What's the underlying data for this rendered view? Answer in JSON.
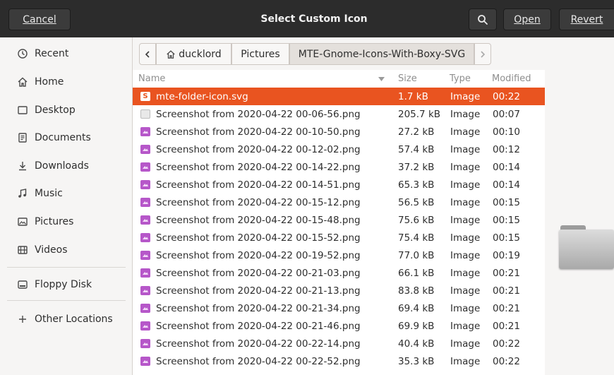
{
  "header": {
    "cancel_label": "Cancel",
    "title": "Select Custom Icon",
    "search_icon": "search-icon",
    "open_label": "Open",
    "revert_label": "Revert"
  },
  "sidebar": {
    "items": [
      {
        "label": "Recent",
        "icon": "clock-icon"
      },
      {
        "label": "Home",
        "icon": "home-icon"
      },
      {
        "label": "Desktop",
        "icon": "desktop-icon"
      },
      {
        "label": "Documents",
        "icon": "document-icon"
      },
      {
        "label": "Downloads",
        "icon": "download-icon"
      },
      {
        "label": "Music",
        "icon": "music-icon"
      },
      {
        "label": "Pictures",
        "icon": "image-icon"
      },
      {
        "label": "Videos",
        "icon": "video-icon"
      },
      {
        "label": "Floppy Disk",
        "icon": "drive-icon"
      },
      {
        "label": "Other Locations",
        "icon": "plus-icon"
      }
    ]
  },
  "pathbar": {
    "segments": [
      "ducklord",
      "Pictures",
      "MTE-Gnome-Icons-With-Boxy-SVG"
    ]
  },
  "list": {
    "columns": {
      "name": "Name",
      "size": "Size",
      "type": "Type",
      "modified": "Modified"
    },
    "rows": [
      {
        "name": "mte-folder-icon.svg",
        "size": "1.7 kB",
        "type": "Image",
        "modified": "00:22",
        "selected": true,
        "icon": "svg-file-icon"
      },
      {
        "name": "Screenshot from 2020-04-22 00-06-56.png",
        "size": "205.7 kB",
        "type": "Image",
        "modified": "00:07",
        "icon": "generic-image-icon"
      },
      {
        "name": "Screenshot from 2020-04-22 00-10-50.png",
        "size": "27.2 kB",
        "type": "Image",
        "modified": "00:10",
        "icon": "png-file-icon"
      },
      {
        "name": "Screenshot from 2020-04-22 00-12-02.png",
        "size": "57.4 kB",
        "type": "Image",
        "modified": "00:12",
        "icon": "png-file-icon"
      },
      {
        "name": "Screenshot from 2020-04-22 00-14-22.png",
        "size": "37.2 kB",
        "type": "Image",
        "modified": "00:14",
        "icon": "png-file-icon"
      },
      {
        "name": "Screenshot from 2020-04-22 00-14-51.png",
        "size": "65.3 kB",
        "type": "Image",
        "modified": "00:14",
        "icon": "png-file-icon"
      },
      {
        "name": "Screenshot from 2020-04-22 00-15-12.png",
        "size": "56.5 kB",
        "type": "Image",
        "modified": "00:15",
        "icon": "png-file-icon"
      },
      {
        "name": "Screenshot from 2020-04-22 00-15-48.png",
        "size": "75.6 kB",
        "type": "Image",
        "modified": "00:15",
        "icon": "png-file-icon"
      },
      {
        "name": "Screenshot from 2020-04-22 00-15-52.png",
        "size": "75.4 kB",
        "type": "Image",
        "modified": "00:15",
        "icon": "png-file-icon"
      },
      {
        "name": "Screenshot from 2020-04-22 00-19-52.png",
        "size": "77.0 kB",
        "type": "Image",
        "modified": "00:19",
        "icon": "png-file-icon"
      },
      {
        "name": "Screenshot from 2020-04-22 00-21-03.png",
        "size": "66.1 kB",
        "type": "Image",
        "modified": "00:21",
        "icon": "png-file-icon"
      },
      {
        "name": "Screenshot from 2020-04-22 00-21-13.png",
        "size": "83.8 kB",
        "type": "Image",
        "modified": "00:21",
        "icon": "png-file-icon"
      },
      {
        "name": "Screenshot from 2020-04-22 00-21-34.png",
        "size": "69.4 kB",
        "type": "Image",
        "modified": "00:21",
        "icon": "png-file-icon"
      },
      {
        "name": "Screenshot from 2020-04-22 00-21-46.png",
        "size": "69.9 kB",
        "type": "Image",
        "modified": "00:21",
        "icon": "png-file-icon"
      },
      {
        "name": "Screenshot from 2020-04-22 00-22-14.png",
        "size": "40.4 kB",
        "type": "Image",
        "modified": "00:22",
        "icon": "png-file-icon"
      },
      {
        "name": "Screenshot from 2020-04-22 00-22-52.png",
        "size": "35.3 kB",
        "type": "Image",
        "modified": "00:22",
        "icon": "png-file-icon"
      }
    ]
  },
  "preview": {
    "icon": "folder-icon"
  },
  "colors": {
    "selection": "#e95420",
    "headerbar": "#2c2c2c",
    "png_icon": "#b657c9"
  }
}
